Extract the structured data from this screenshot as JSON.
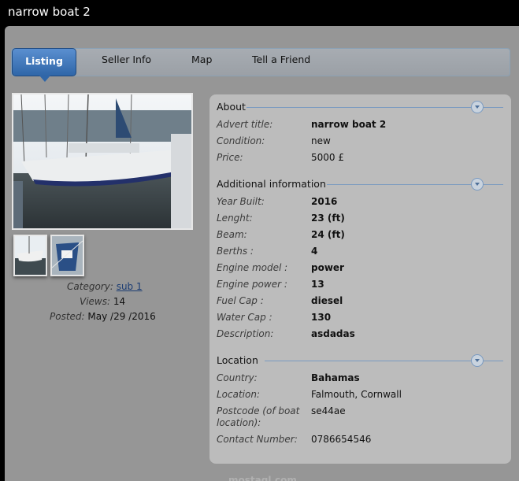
{
  "window": {
    "title": "narrow boat 2"
  },
  "tabs": [
    {
      "label": "Listing",
      "active": true
    },
    {
      "label": "Seller Info",
      "active": false
    },
    {
      "label": "Map",
      "active": false
    },
    {
      "label": "Tell a Friend",
      "active": false
    }
  ],
  "listing_meta": {
    "category_label": "Category:",
    "category_value": "sub 1",
    "views_label": "Views:",
    "views_value": "14",
    "posted_label": "Posted:",
    "posted_value": "May /29 /2016"
  },
  "about": {
    "heading": "About",
    "rows": [
      {
        "label": "Advert title:",
        "value": "narrow boat 2"
      },
      {
        "label": "Condition:",
        "value": "new"
      },
      {
        "label": "Price:",
        "value": "5000 £"
      }
    ]
  },
  "additional": {
    "heading": "Additional information",
    "rows": [
      {
        "label": "Year Built:",
        "value": "2016"
      },
      {
        "label": "Lenght:",
        "value": "23 (ft)"
      },
      {
        "label": "Beam:",
        "value": "24 (ft)"
      },
      {
        "label": "Berths :",
        "value": "4"
      },
      {
        "label": "Engine model :",
        "value": "power"
      },
      {
        "label": "Engine power :",
        "value": "13"
      },
      {
        "label": "Fuel Cap :",
        "value": "diesel"
      },
      {
        "label": "Water Cap :",
        "value": "130"
      },
      {
        "label": "Description:",
        "value": "asdadas"
      }
    ]
  },
  "location": {
    "heading": "Location",
    "rows": [
      {
        "label": "Country:",
        "value": "Bahamas"
      },
      {
        "label": "Location:",
        "value": "Falmouth, Cornwall"
      },
      {
        "label": "Postcode (of boat location):",
        "value": "se44ae"
      },
      {
        "label": "Contact Number:",
        "value": "0786654546"
      }
    ]
  },
  "watermark": "mostaql.com",
  "colors": {
    "accent": "#2f66a8",
    "panel": "#969696",
    "card": "#bcbcbc"
  }
}
